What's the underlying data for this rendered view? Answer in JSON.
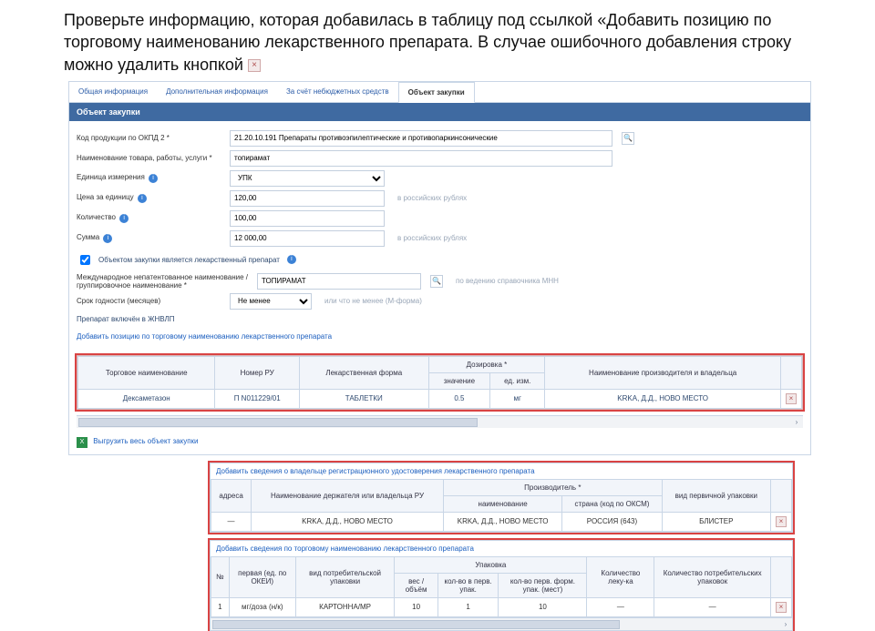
{
  "instructions": "Проверьте информацию, которая добавилась в таблицу под ссылкой «Добавить позицию по торговому наименованию лекарственного препарата. В случае ошибочного добавления строку можно удалить кнопкой",
  "delete_glyph": "×",
  "tabs": {
    "t0": "Общая информация",
    "t1": "Дополнительная информация",
    "t2": "За счёт небюджетных средств",
    "t3": "Объект закупки"
  },
  "section_header": "Объект закупки",
  "form": {
    "okpd_label": "Код продукции по ОКПД 2 *",
    "okpd_value": "21.20.10.191 Препараты противоэпилептические и противопаркинсонические",
    "name_label": "Наименование товара, работы, услуги *",
    "name_value": "топирамат",
    "currency_label": "Единица измерения",
    "currency_value": "УПК",
    "price_label": "Цена за единицу",
    "price_value": "120,00",
    "price_hint": "в российских рублях",
    "qty_label": "Количество",
    "qty_value": "100,00",
    "sum_label": "Сумма",
    "sum_value": "12 000,00",
    "sum_hint": "в российских рублях",
    "cb1_label": "Объектом закупки является лекарственный препарат",
    "mnn_label": "Международное непатентованное наименование / группировочное наименование *",
    "mnn_value": "ТОПИРАМАТ",
    "mnn_hint": "по ведению справочника МНН",
    "term_label": "Срок годности (месяцев)",
    "term_value": "Не менее",
    "term_extra": "или что не менее (М-форма)",
    "jnvlp": "Препарат включён в ЖНВЛП",
    "add_link": "Добавить позицию по торговому наименованию лекарственного препарата"
  },
  "table1": {
    "h_trade": "Торговое наименование",
    "h_ru": "Номер РУ",
    "h_form": "Лекарственная форма",
    "h_dos_group": "Дозировка *",
    "h_dos1": "значение",
    "h_dos2": "ед. изм.",
    "h_manuf": "Наименование производителя и владельца",
    "r_trade": "Дексаметазон",
    "r_ru": "П N011229/01",
    "r_form": "ТАБЛЕТКИ",
    "r_d1": "0.5",
    "r_d2": "мг",
    "r_manuf": "KRKA, Д.Д., НОВО МЕСТО"
  },
  "caption_holders": "Добавить сведения о владельце регистрационного удостоверения лекарственного препарата",
  "table2": {
    "h_id": "адреса",
    "h_holder": "Наименование держателя или владельца РУ",
    "h_manuf_group": "Производитель *",
    "h_manuf": "наименование",
    "h_country": "страна (код по ОКСМ)",
    "h_pack": "вид первичной упаковки",
    "r_id": "—",
    "r_holder": "KRKA, Д.Д., НОВО МЕСТО",
    "r_manuf": "KRKA, Д.Д., НОВО МЕСТО",
    "r_country": "РОССИЯ (643)",
    "r_pack": "БЛИСТЕР"
  },
  "caption_pack": "Добавить сведения по торговому наименованию лекарственного препарата",
  "table3": {
    "h_id": "№",
    "h_primary": "первая (ед. по ОКЕИ)",
    "h_consumer": "вид потребительской упаковки",
    "h_up_group": "Упаковка",
    "h_u1": "вес / объём",
    "h_u2": "кол-во в перв. упак.",
    "h_u3": "кол-во перв. форм. упак. (мест)",
    "h_count": "Количество леку-ка",
    "h_inpack": "Количество потребительских упаковок",
    "r_primary": "мг/доза (н/к)",
    "r_consumer": "КАРТОННА/МР",
    "r_u1": "10",
    "r_u2": "1",
    "r_u3": "10",
    "r_count": "—",
    "r_inpack": "—"
  },
  "export_label": "Выгрузить весь объект закупки",
  "info_glyph": "i",
  "search_glyph": "🔍",
  "excel_glyph": "X"
}
